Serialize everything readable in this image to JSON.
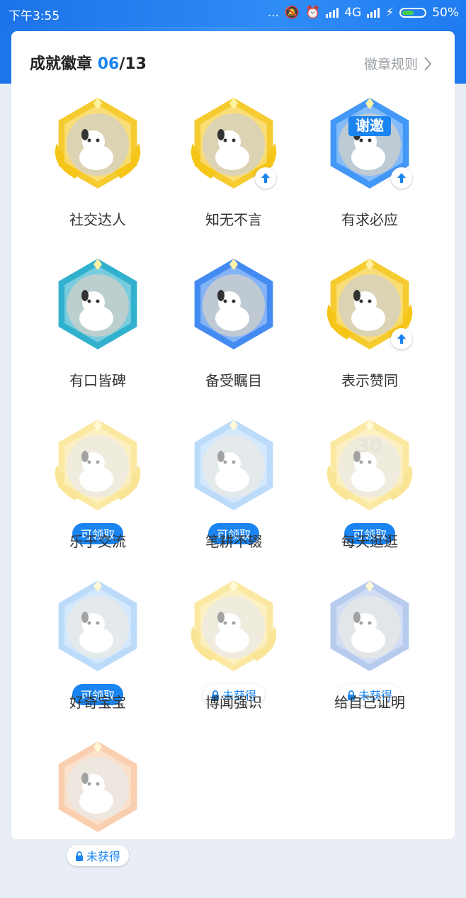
{
  "status_bar": {
    "time": "下午3:55",
    "dots": "...",
    "network": "4G",
    "battery": "50%"
  },
  "header": {
    "title": "成就徽章",
    "earned": "06",
    "total": "/13",
    "rules_link": "徽章规则"
  },
  "badges": [
    {
      "label": "社交达人",
      "state": "earned",
      "color": "#f5c518",
      "icon": "polar-bear-icon"
    },
    {
      "label": "知无不言",
      "state": "earned-upgrade",
      "color": "#f5c518",
      "icon": "pencil-icon"
    },
    {
      "label": "有求必应",
      "state": "earned-upgrade",
      "color": "#2f8cf5",
      "icon": "thanks-sign-icon",
      "sign": "谢邀"
    },
    {
      "label": "有口皆碑",
      "state": "earned",
      "color": "#1ba8c9",
      "icon": "megaphone-icon"
    },
    {
      "label": "备受瞩目",
      "state": "earned",
      "color": "#2f7ef0",
      "icon": "heart-icon"
    },
    {
      "label": "表示赞同",
      "state": "earned-upgrade",
      "color": "#f5c518",
      "icon": "thumb-up-icon"
    },
    {
      "label": "乐于交流",
      "state": "claimable",
      "color": "#f5c518",
      "icon": "chat-bubble-icon",
      "pill": "可领取"
    },
    {
      "label": "笔耕不辍",
      "state": "claimable",
      "color": "#5aa7f3",
      "icon": "moon-icon",
      "pill": "可领取"
    },
    {
      "label": "每天逛逛",
      "state": "claimable",
      "color": "#f5c518",
      "icon": "calendar-30-icon",
      "pill": "可领取",
      "sign": "30"
    },
    {
      "label": "好奇宝宝",
      "state": "claimable",
      "color": "#5aa7f3",
      "icon": "question-icon",
      "pill": "可领取"
    },
    {
      "label": "博闻强识",
      "state": "locked",
      "color": "#f5c518",
      "icon": "star-icon",
      "pill": "未获得"
    },
    {
      "label": "给自己证明",
      "state": "locked",
      "color": "#4d7fd6",
      "icon": "laurel-icon",
      "pill": "未获得"
    },
    {
      "label": "",
      "state": "locked",
      "color": "#f08a3c",
      "icon": "book-icon",
      "pill": "未获得"
    }
  ]
}
